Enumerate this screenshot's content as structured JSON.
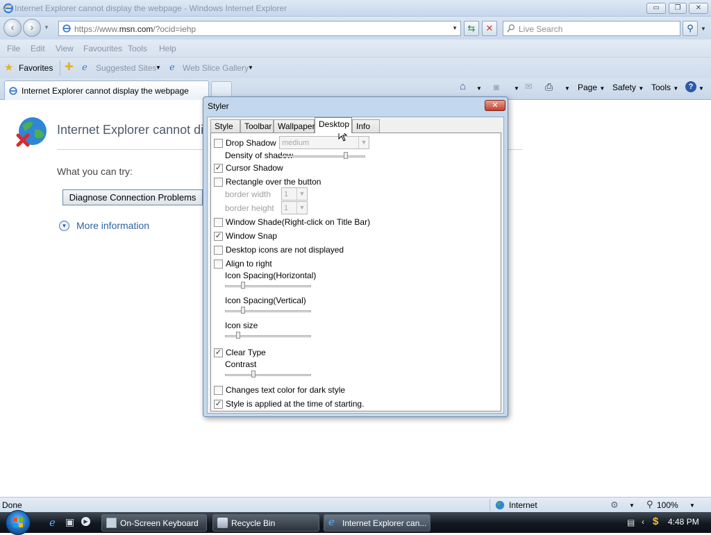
{
  "window": {
    "title": "Internet Explorer cannot display the webpage - Windows Internet Explorer",
    "minimize": "▭",
    "maximize": "❐",
    "close": "✕"
  },
  "navbar": {
    "back": "‹",
    "forward": "›",
    "address_prefix": "https://www.",
    "address_domain": "msn.com",
    "address_suffix": "/?ocid=iehp",
    "search_placeholder": "Live Search"
  },
  "menu": [
    "File",
    "Edit",
    "View",
    "Favourites",
    "Tools",
    "Help"
  ],
  "favorites_bar": {
    "favorites_label": "Favorites",
    "suggested_sites": "Suggested Sites",
    "web_slice_gallery": "Web Slice Gallery"
  },
  "tabs": {
    "active_tab_title": "Internet Explorer cannot display the webpage"
  },
  "command_bar": {
    "page": "Page",
    "safety": "Safety",
    "tools": "Tools"
  },
  "page": {
    "heading": "Internet Explorer cannot di",
    "try_text": "What you can try:",
    "diagnose_button": "Diagnose Connection Problems",
    "more_info": "More information"
  },
  "styler": {
    "title": "Styler",
    "close_glyph": "✕",
    "tabs": [
      "Style",
      "Toolbar",
      "Wallpaper",
      "Desktop",
      "Info"
    ],
    "active_tab": "Desktop",
    "drop_shadow": {
      "label": "Drop Shadow",
      "checked": false,
      "combo_value": "medium"
    },
    "density_of_shadow": "Density of shadow",
    "cursor_shadow": {
      "label": "Cursor Shadow",
      "checked": true
    },
    "rectangle_over_button": {
      "label": "Rectangle over the button",
      "checked": false
    },
    "border_width": {
      "label": "border width",
      "value": "1"
    },
    "border_height": {
      "label": "border height",
      "value": "1"
    },
    "window_shade": {
      "label": "Window Shade(Right-click on Title Bar)",
      "checked": false
    },
    "window_snap": {
      "label": "Window Snap",
      "checked": true
    },
    "desktop_icons_hidden": {
      "label": "Desktop icons are not displayed",
      "checked": false
    },
    "align_to_right": {
      "label": "Align to right",
      "checked": false
    },
    "icon_spacing_h": "Icon Spacing(Horizontal)",
    "icon_spacing_v": "Icon Spacing(Vertical)",
    "icon_size": "Icon size",
    "clear_type": {
      "label": "Clear Type",
      "checked": true
    },
    "contrast": "Contrast",
    "dark_style_text_color": {
      "label": "Changes text color for dark style",
      "checked": false
    },
    "apply_at_start": {
      "label": "Style is applied at the time of starting.",
      "checked": true
    },
    "check_glyph": "✓"
  },
  "statusbar": {
    "status": "Done",
    "zone": "Internet",
    "zoom": "100%"
  },
  "taskbar": {
    "items": [
      "On-Screen Keyboard",
      "Recycle Bin",
      "Internet Explorer can..."
    ],
    "clock": "4:48 PM"
  },
  "colors": {
    "accent_blue": "#2d63a7",
    "title_gray": "#8a98aa",
    "close_red": "#c2402c"
  }
}
